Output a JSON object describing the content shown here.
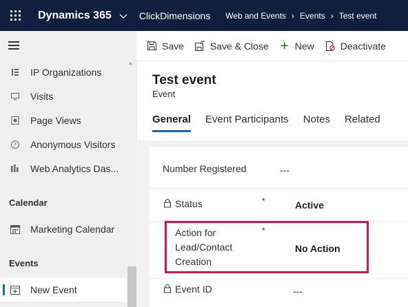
{
  "topbar": {
    "app_title": "Dynamics 365",
    "module": "ClickDimensions",
    "breadcrumbs": [
      "Web and Events",
      "Events",
      "Test event"
    ],
    "background": "#0f1f3d"
  },
  "sidebar": {
    "items_top": [
      {
        "label": "IP Organizations",
        "icon": "ip-organizations-icon"
      },
      {
        "label": "Visits",
        "icon": "monitor-icon"
      },
      {
        "label": "Page Views",
        "icon": "page-views-icon"
      },
      {
        "label": "Anonymous Visitors",
        "icon": "anonymous-visitor-icon"
      },
      {
        "label": "Web Analytics Das...",
        "icon": "analytics-icon"
      }
    ],
    "calendar_header": "Calendar",
    "calendar_item": {
      "label": "Marketing Calendar",
      "icon": "calendar-icon"
    },
    "events_header": "Events",
    "events_item": {
      "label": "New Event",
      "icon": "new-event-icon",
      "selected": true
    }
  },
  "commandbar": {
    "save": "Save",
    "save_close": "Save & Close",
    "new": "New",
    "deactivate": "Deactivate"
  },
  "record": {
    "title": "Test event",
    "type": "Event"
  },
  "tabs": [
    {
      "label": "General",
      "active": true
    },
    {
      "label": "Event Participants",
      "active": false
    },
    {
      "label": "Notes",
      "active": false
    },
    {
      "label": "Related",
      "active": false
    }
  ],
  "form": {
    "number_registered": {
      "label": "Number Registered",
      "value": "---"
    },
    "status": {
      "label": "Status",
      "value": "Active",
      "required": "*"
    },
    "action": {
      "label_lines": [
        "Action for",
        "Lead/Contact",
        "Creation"
      ],
      "value": "No Action",
      "required": "*"
    },
    "event_id": {
      "label": "Event ID",
      "value": "---"
    }
  },
  "colors": {
    "accent": "#0f6cbd",
    "highlight": "#d4145a",
    "required": "#c00000"
  }
}
